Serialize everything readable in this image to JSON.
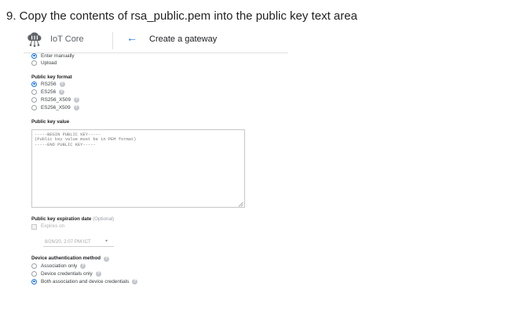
{
  "instruction": "9. Copy the contents of rsa_public.pem into the public key text area",
  "header": {
    "product_name": "IoT Core",
    "page_title": "Create a gateway"
  },
  "input_method": {
    "options": [
      {
        "label": "Enter manually",
        "selected": true
      },
      {
        "label": "Upload",
        "selected": false
      }
    ]
  },
  "public_key_format": {
    "label": "Public key format",
    "options": [
      {
        "label": "RS256",
        "selected": true
      },
      {
        "label": "ES256",
        "selected": false
      },
      {
        "label": "RS256_X509",
        "selected": false
      },
      {
        "label": "ES256_X509",
        "selected": false
      }
    ]
  },
  "public_key_value": {
    "label": "Public key value",
    "placeholder": "-----BEGIN PUBLIC KEY-----\n(Public key value must be in PEM format)\n-----END PUBLIC KEY-----"
  },
  "expiration": {
    "label": "Public key expiration date",
    "optional_label": "(Optional)",
    "checkbox_label": "Expires on",
    "checked": false,
    "date_value": "8/26/20, 2:07 PM ICT"
  },
  "device_auth_method": {
    "label": "Device authentication method",
    "options": [
      {
        "label": "Association only",
        "selected": false
      },
      {
        "label": "Device credentials only",
        "selected": false
      },
      {
        "label": "Both association and device credentials",
        "selected": true
      }
    ]
  },
  "colors": {
    "accent": "#1a73e8",
    "help_icon": "#c4c7cc"
  },
  "icons": {
    "logo": "iot-core-cloud-icon",
    "back": "back-arrow-icon",
    "help": "help-icon"
  }
}
